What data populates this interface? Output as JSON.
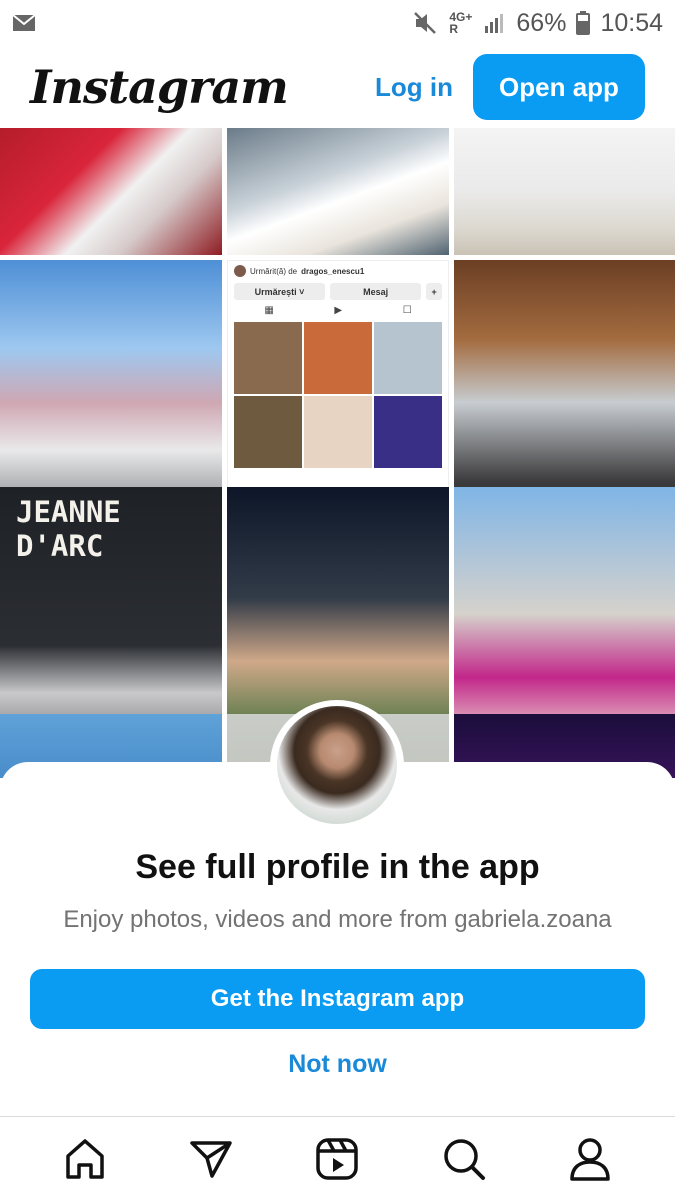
{
  "status_bar": {
    "network_top": "4G+",
    "network_bottom": "R",
    "battery": "66%",
    "time": "10:54",
    "icons": [
      "mail-icon",
      "mute-icon",
      "signal-icon",
      "battery-icon"
    ]
  },
  "header": {
    "logo": "Instagram",
    "login_label": "Log in",
    "open_app_label": "Open app"
  },
  "grid": {
    "jeanne_text_1": "JEANNE",
    "jeanne_text_2": "D'ARC",
    "shot": {
      "followed_by": "Urmărit(ă) de",
      "followed_user": "dragos_enescu1",
      "following_btn": "Urmărești ˅",
      "message_btn": "Mesaj",
      "add_btn": "+"
    }
  },
  "sheet": {
    "title": "See full profile in the app",
    "subtitle": "Enjoy photos, videos and more from gabriela.zoana",
    "get_app_label": "Get the Instagram app",
    "not_now_label": "Not now"
  },
  "nav": {
    "items": [
      "home-icon",
      "direct-icon",
      "reels-icon",
      "search-icon",
      "profile-icon"
    ]
  },
  "colors": {
    "accent": "#0a9bf2",
    "link": "#1a8ad8",
    "muted": "#737373"
  }
}
